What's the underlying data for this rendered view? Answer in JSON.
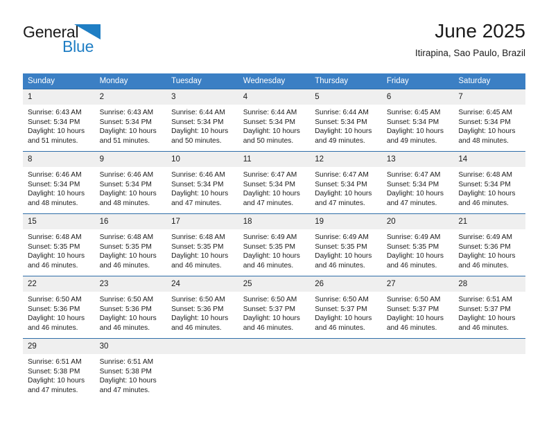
{
  "brand": {
    "name_top": "General",
    "name_bottom": "Blue",
    "triangle_color": "#1f7ec4",
    "top_color": "#1a1a1a",
    "bottom_color": "#1f7ec4"
  },
  "header": {
    "title": "June 2025",
    "subtitle": "Itirapina, Sao Paulo, Brazil"
  },
  "theme": {
    "header_bg": "#3b7fc4",
    "header_text": "#ffffff",
    "row_divider": "#2e6da8",
    "daynum_bg": "#efefef",
    "body_text": "#1a1a1a",
    "page_bg": "#ffffff"
  },
  "weekday_headers": [
    "Sunday",
    "Monday",
    "Tuesday",
    "Wednesday",
    "Thursday",
    "Friday",
    "Saturday"
  ],
  "labels": {
    "sunrise_prefix": "Sunrise:",
    "sunset_prefix": "Sunset:",
    "daylight_prefix": "Daylight:"
  },
  "weeks": [
    [
      {
        "day": "1",
        "sunrise": "Sunrise: 6:43 AM",
        "sunset": "Sunset: 5:34 PM",
        "daylight_line1": "Daylight: 10 hours",
        "daylight_line2": "and 51 minutes."
      },
      {
        "day": "2",
        "sunrise": "Sunrise: 6:43 AM",
        "sunset": "Sunset: 5:34 PM",
        "daylight_line1": "Daylight: 10 hours",
        "daylight_line2": "and 51 minutes."
      },
      {
        "day": "3",
        "sunrise": "Sunrise: 6:44 AM",
        "sunset": "Sunset: 5:34 PM",
        "daylight_line1": "Daylight: 10 hours",
        "daylight_line2": "and 50 minutes."
      },
      {
        "day": "4",
        "sunrise": "Sunrise: 6:44 AM",
        "sunset": "Sunset: 5:34 PM",
        "daylight_line1": "Daylight: 10 hours",
        "daylight_line2": "and 50 minutes."
      },
      {
        "day": "5",
        "sunrise": "Sunrise: 6:44 AM",
        "sunset": "Sunset: 5:34 PM",
        "daylight_line1": "Daylight: 10 hours",
        "daylight_line2": "and 49 minutes."
      },
      {
        "day": "6",
        "sunrise": "Sunrise: 6:45 AM",
        "sunset": "Sunset: 5:34 PM",
        "daylight_line1": "Daylight: 10 hours",
        "daylight_line2": "and 49 minutes."
      },
      {
        "day": "7",
        "sunrise": "Sunrise: 6:45 AM",
        "sunset": "Sunset: 5:34 PM",
        "daylight_line1": "Daylight: 10 hours",
        "daylight_line2": "and 48 minutes."
      }
    ],
    [
      {
        "day": "8",
        "sunrise": "Sunrise: 6:46 AM",
        "sunset": "Sunset: 5:34 PM",
        "daylight_line1": "Daylight: 10 hours",
        "daylight_line2": "and 48 minutes."
      },
      {
        "day": "9",
        "sunrise": "Sunrise: 6:46 AM",
        "sunset": "Sunset: 5:34 PM",
        "daylight_line1": "Daylight: 10 hours",
        "daylight_line2": "and 48 minutes."
      },
      {
        "day": "10",
        "sunrise": "Sunrise: 6:46 AM",
        "sunset": "Sunset: 5:34 PM",
        "daylight_line1": "Daylight: 10 hours",
        "daylight_line2": "and 47 minutes."
      },
      {
        "day": "11",
        "sunrise": "Sunrise: 6:47 AM",
        "sunset": "Sunset: 5:34 PM",
        "daylight_line1": "Daylight: 10 hours",
        "daylight_line2": "and 47 minutes."
      },
      {
        "day": "12",
        "sunrise": "Sunrise: 6:47 AM",
        "sunset": "Sunset: 5:34 PM",
        "daylight_line1": "Daylight: 10 hours",
        "daylight_line2": "and 47 minutes."
      },
      {
        "day": "13",
        "sunrise": "Sunrise: 6:47 AM",
        "sunset": "Sunset: 5:34 PM",
        "daylight_line1": "Daylight: 10 hours",
        "daylight_line2": "and 47 minutes."
      },
      {
        "day": "14",
        "sunrise": "Sunrise: 6:48 AM",
        "sunset": "Sunset: 5:34 PM",
        "daylight_line1": "Daylight: 10 hours",
        "daylight_line2": "and 46 minutes."
      }
    ],
    [
      {
        "day": "15",
        "sunrise": "Sunrise: 6:48 AM",
        "sunset": "Sunset: 5:35 PM",
        "daylight_line1": "Daylight: 10 hours",
        "daylight_line2": "and 46 minutes."
      },
      {
        "day": "16",
        "sunrise": "Sunrise: 6:48 AM",
        "sunset": "Sunset: 5:35 PM",
        "daylight_line1": "Daylight: 10 hours",
        "daylight_line2": "and 46 minutes."
      },
      {
        "day": "17",
        "sunrise": "Sunrise: 6:48 AM",
        "sunset": "Sunset: 5:35 PM",
        "daylight_line1": "Daylight: 10 hours",
        "daylight_line2": "and 46 minutes."
      },
      {
        "day": "18",
        "sunrise": "Sunrise: 6:49 AM",
        "sunset": "Sunset: 5:35 PM",
        "daylight_line1": "Daylight: 10 hours",
        "daylight_line2": "and 46 minutes."
      },
      {
        "day": "19",
        "sunrise": "Sunrise: 6:49 AM",
        "sunset": "Sunset: 5:35 PM",
        "daylight_line1": "Daylight: 10 hours",
        "daylight_line2": "and 46 minutes."
      },
      {
        "day": "20",
        "sunrise": "Sunrise: 6:49 AM",
        "sunset": "Sunset: 5:35 PM",
        "daylight_line1": "Daylight: 10 hours",
        "daylight_line2": "and 46 minutes."
      },
      {
        "day": "21",
        "sunrise": "Sunrise: 6:49 AM",
        "sunset": "Sunset: 5:36 PM",
        "daylight_line1": "Daylight: 10 hours",
        "daylight_line2": "and 46 minutes."
      }
    ],
    [
      {
        "day": "22",
        "sunrise": "Sunrise: 6:50 AM",
        "sunset": "Sunset: 5:36 PM",
        "daylight_line1": "Daylight: 10 hours",
        "daylight_line2": "and 46 minutes."
      },
      {
        "day": "23",
        "sunrise": "Sunrise: 6:50 AM",
        "sunset": "Sunset: 5:36 PM",
        "daylight_line1": "Daylight: 10 hours",
        "daylight_line2": "and 46 minutes."
      },
      {
        "day": "24",
        "sunrise": "Sunrise: 6:50 AM",
        "sunset": "Sunset: 5:36 PM",
        "daylight_line1": "Daylight: 10 hours",
        "daylight_line2": "and 46 minutes."
      },
      {
        "day": "25",
        "sunrise": "Sunrise: 6:50 AM",
        "sunset": "Sunset: 5:37 PM",
        "daylight_line1": "Daylight: 10 hours",
        "daylight_line2": "and 46 minutes."
      },
      {
        "day": "26",
        "sunrise": "Sunrise: 6:50 AM",
        "sunset": "Sunset: 5:37 PM",
        "daylight_line1": "Daylight: 10 hours",
        "daylight_line2": "and 46 minutes."
      },
      {
        "day": "27",
        "sunrise": "Sunrise: 6:50 AM",
        "sunset": "Sunset: 5:37 PM",
        "daylight_line1": "Daylight: 10 hours",
        "daylight_line2": "and 46 minutes."
      },
      {
        "day": "28",
        "sunrise": "Sunrise: 6:51 AM",
        "sunset": "Sunset: 5:37 PM",
        "daylight_line1": "Daylight: 10 hours",
        "daylight_line2": "and 46 minutes."
      }
    ],
    [
      {
        "day": "29",
        "sunrise": "Sunrise: 6:51 AM",
        "sunset": "Sunset: 5:38 PM",
        "daylight_line1": "Daylight: 10 hours",
        "daylight_line2": "and 47 minutes."
      },
      {
        "day": "30",
        "sunrise": "Sunrise: 6:51 AM",
        "sunset": "Sunset: 5:38 PM",
        "daylight_line1": "Daylight: 10 hours",
        "daylight_line2": "and 47 minutes."
      },
      {
        "day": "",
        "sunrise": "",
        "sunset": "",
        "daylight_line1": "",
        "daylight_line2": ""
      },
      {
        "day": "",
        "sunrise": "",
        "sunset": "",
        "daylight_line1": "",
        "daylight_line2": ""
      },
      {
        "day": "",
        "sunrise": "",
        "sunset": "",
        "daylight_line1": "",
        "daylight_line2": ""
      },
      {
        "day": "",
        "sunrise": "",
        "sunset": "",
        "daylight_line1": "",
        "daylight_line2": ""
      },
      {
        "day": "",
        "sunrise": "",
        "sunset": "",
        "daylight_line1": "",
        "daylight_line2": ""
      }
    ]
  ]
}
